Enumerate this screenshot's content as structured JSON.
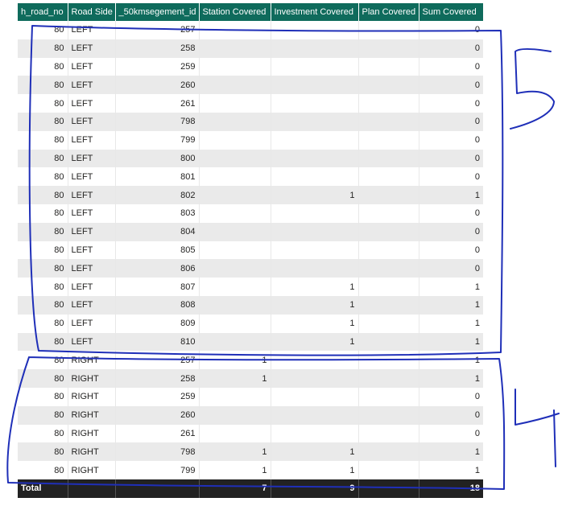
{
  "table": {
    "columns": [
      "h_road_no",
      "Road Side",
      "_50kmsegement_id",
      "Station Covered",
      "Investment Covered",
      "Plan Covered",
      "Sum Covered"
    ],
    "rows": [
      [
        "80",
        "LEFT",
        "257",
        "",
        "",
        "",
        "0"
      ],
      [
        "80",
        "LEFT",
        "258",
        "",
        "",
        "",
        "0"
      ],
      [
        "80",
        "LEFT",
        "259",
        "",
        "",
        "",
        "0"
      ],
      [
        "80",
        "LEFT",
        "260",
        "",
        "",
        "",
        "0"
      ],
      [
        "80",
        "LEFT",
        "261",
        "",
        "",
        "",
        "0"
      ],
      [
        "80",
        "LEFT",
        "798",
        "",
        "",
        "",
        "0"
      ],
      [
        "80",
        "LEFT",
        "799",
        "",
        "",
        "",
        "0"
      ],
      [
        "80",
        "LEFT",
        "800",
        "",
        "",
        "",
        "0"
      ],
      [
        "80",
        "LEFT",
        "801",
        "",
        "",
        "",
        "0"
      ],
      [
        "80",
        "LEFT",
        "802",
        "",
        "1",
        "",
        "1"
      ],
      [
        "80",
        "LEFT",
        "803",
        "",
        "",
        "",
        "0"
      ],
      [
        "80",
        "LEFT",
        "804",
        "",
        "",
        "",
        "0"
      ],
      [
        "80",
        "LEFT",
        "805",
        "",
        "",
        "",
        "0"
      ],
      [
        "80",
        "LEFT",
        "806",
        "",
        "",
        "",
        "0"
      ],
      [
        "80",
        "LEFT",
        "807",
        "",
        "1",
        "",
        "1"
      ],
      [
        "80",
        "LEFT",
        "808",
        "",
        "1",
        "",
        "1"
      ],
      [
        "80",
        "LEFT",
        "809",
        "",
        "1",
        "",
        "1"
      ],
      [
        "80",
        "LEFT",
        "810",
        "",
        "1",
        "",
        "1"
      ],
      [
        "80",
        "RIGHT",
        "257",
        "1",
        "",
        "",
        "1"
      ],
      [
        "80",
        "RIGHT",
        "258",
        "1",
        "",
        "",
        "1"
      ],
      [
        "80",
        "RIGHT",
        "259",
        "",
        "",
        "",
        "0"
      ],
      [
        "80",
        "RIGHT",
        "260",
        "",
        "",
        "",
        "0"
      ],
      [
        "80",
        "RIGHT",
        "261",
        "",
        "",
        "",
        "0"
      ],
      [
        "80",
        "RIGHT",
        "798",
        "1",
        "1",
        "",
        "1"
      ],
      [
        "80",
        "RIGHT",
        "799",
        "1",
        "1",
        "",
        "1"
      ]
    ],
    "totals": {
      "label": "Total",
      "values": [
        "",
        "",
        "",
        "7",
        "9",
        "",
        "18"
      ]
    }
  },
  "annotations": {
    "left_group_label": "5",
    "right_group_label": "4",
    "ink_color": "#1f2fb8"
  }
}
